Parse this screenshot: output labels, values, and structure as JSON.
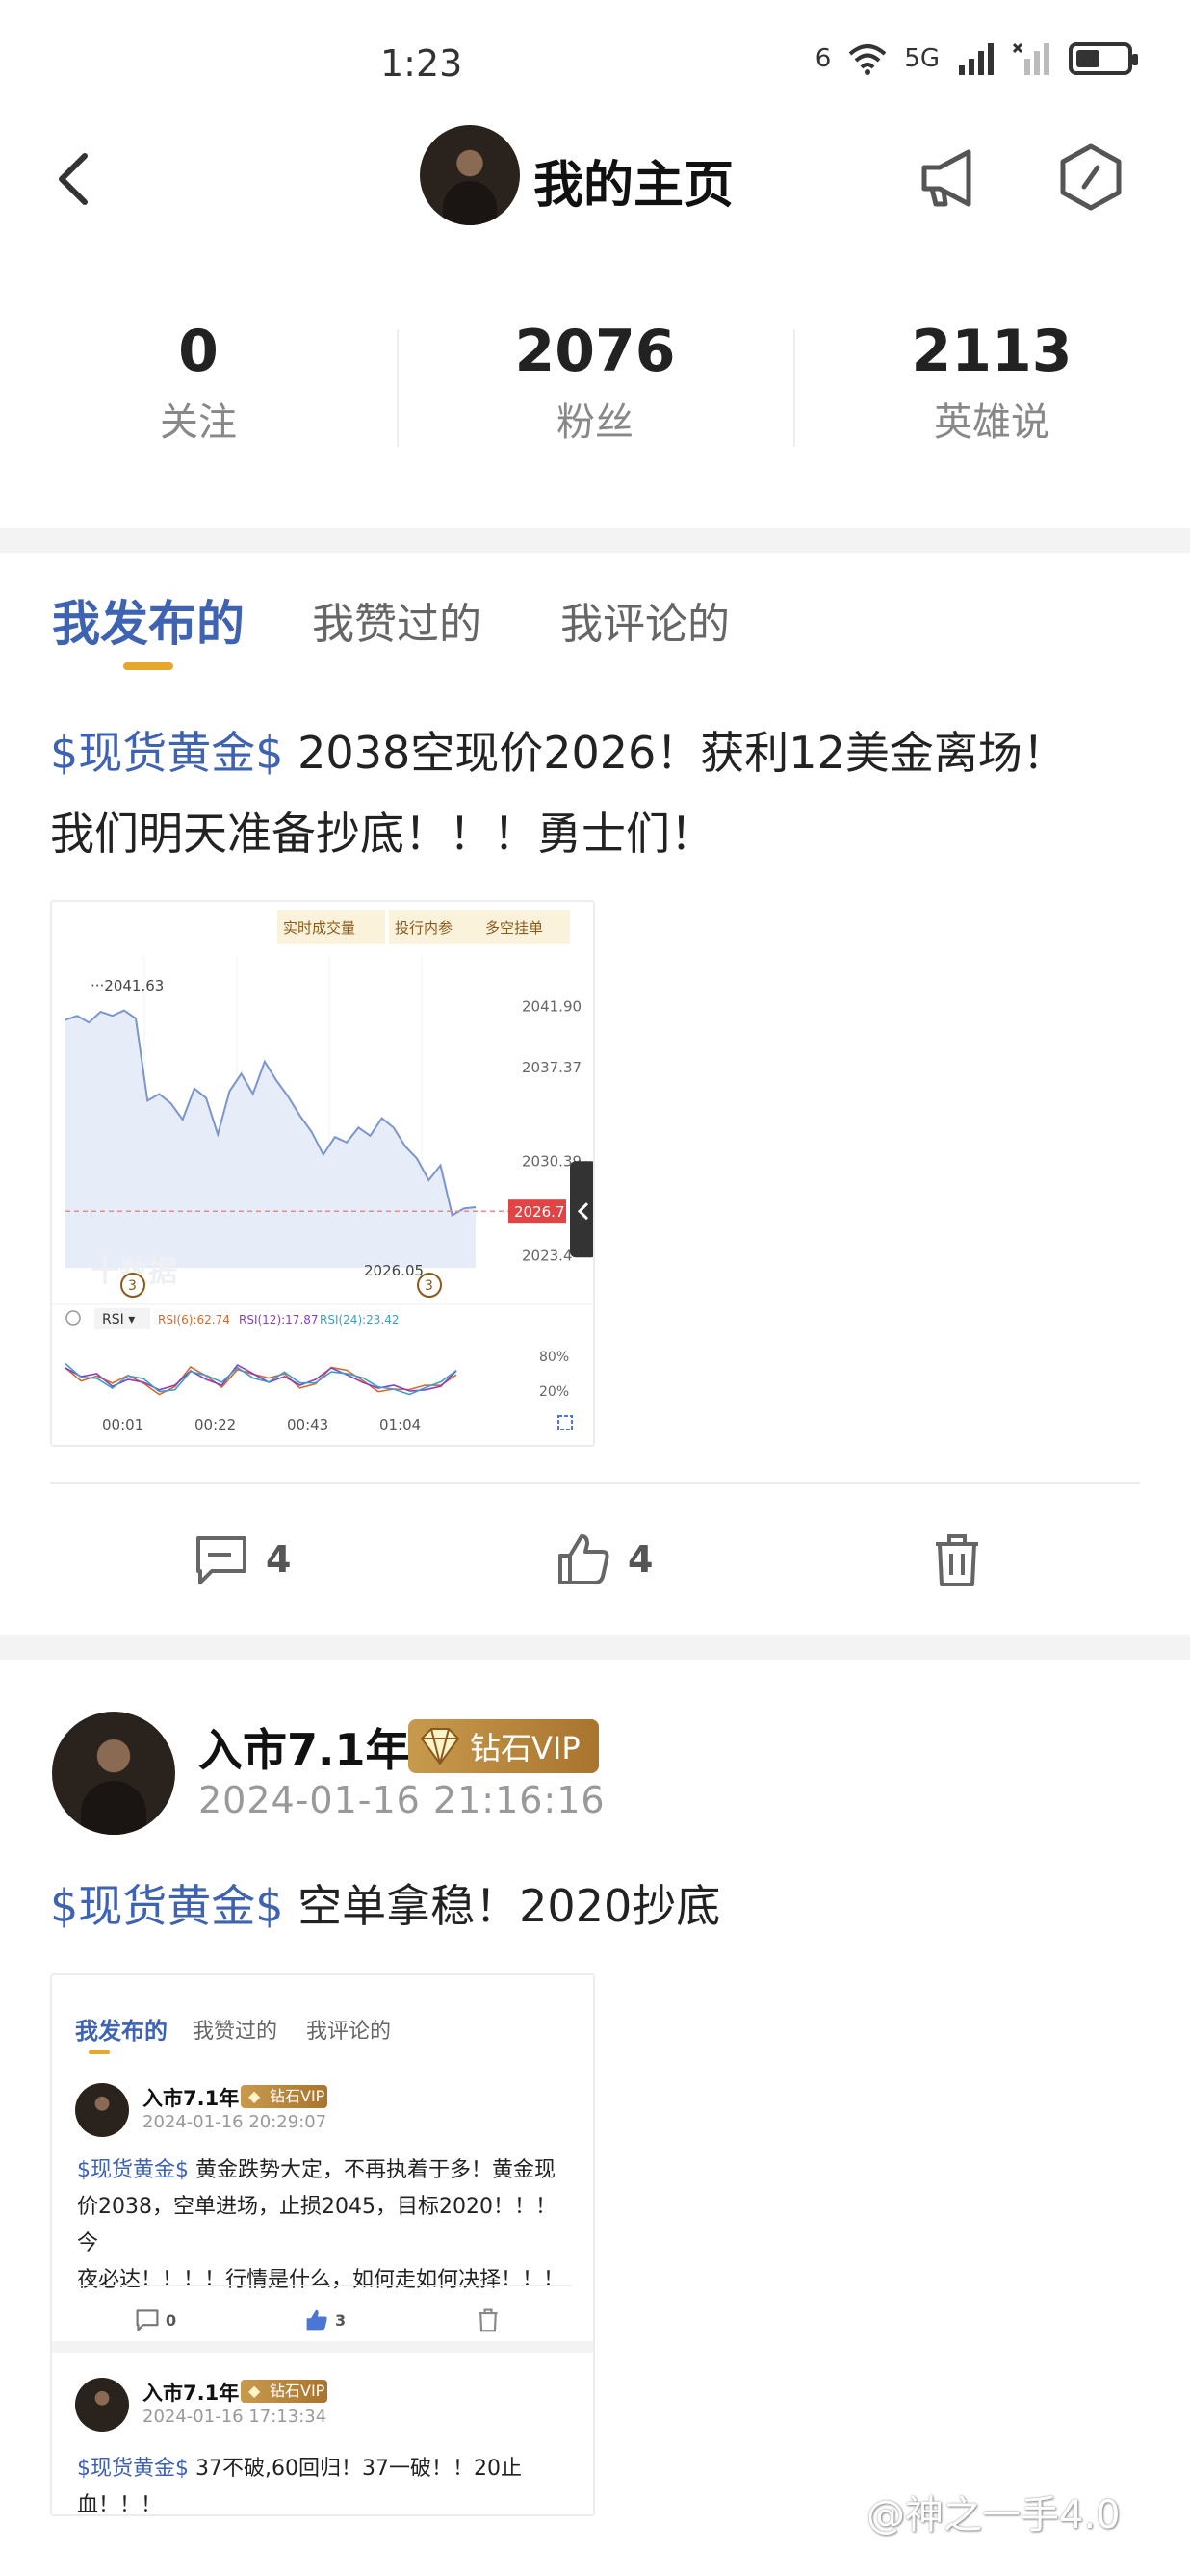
{
  "status_bar": {
    "time": "1:23",
    "signal_labels": [
      "6",
      "5G"
    ]
  },
  "header": {
    "title": "我的主页"
  },
  "stats": [
    {
      "value": "0",
      "label": "关注"
    },
    {
      "value": "2076",
      "label": "粉丝"
    },
    {
      "value": "2113",
      "label": "英雄说"
    }
  ],
  "tabs": [
    {
      "label": "我发布的",
      "active": true
    },
    {
      "label": "我赞过的",
      "active": false
    },
    {
      "label": "我评论的",
      "active": false
    }
  ],
  "post1": {
    "tag": "$现货黄金$",
    "text_line1": " 2038空现价2026！获利12美金离场！",
    "text_line2": "我们明天准备抄底！！！勇士们！",
    "comments": "4",
    "likes": "4"
  },
  "chart_data": {
    "type": "line",
    "buttons": [
      "实时成交量",
      "投行内参",
      "多空挂单"
    ],
    "high_label": "2041.63",
    "low_label": "2026.05",
    "y_ticks": [
      "2041.90",
      "2037.37",
      "2030.39",
      "2023.4"
    ],
    "current_price": "2026.7",
    "x_ticks": [
      "00:01",
      "00:22",
      "00:43",
      "01:04"
    ],
    "indicator": "RSI",
    "rsi_labels": [
      "RSI(6):62.74",
      "RSI(12):17.87",
      "RSI(24):23.42"
    ],
    "rsi_ticks": [
      "80%",
      "20%"
    ],
    "markers": [
      "3",
      "3"
    ],
    "watermark": "十数据",
    "series": [
      {
        "values": [
          2040.9,
          2041.2,
          2040.7,
          2041.5,
          2041.2,
          2041.6,
          2041.0,
          2034.9,
          2035.4,
          2034.7,
          2033.5,
          2035.8,
          2035.1,
          2032.4,
          2035.6,
          2036.9,
          2035.4,
          2037.8,
          2036.4,
          2035.2,
          2033.8,
          2032.6,
          2030.9,
          2032.2,
          2031.8,
          2032.9,
          2032.3,
          2033.6,
          2032.9,
          2031.5,
          2030.6,
          2029.0,
          2030.1,
          2026.4,
          2026.9,
          2027.0
        ]
      },
      {
        "values": [
          60,
          45,
          50,
          28,
          40,
          35,
          22,
          30,
          55,
          40,
          30,
          65,
          50,
          35,
          45,
          30,
          40,
          60,
          48,
          35,
          25,
          30,
          20,
          22,
          28,
          55
        ]
      }
    ]
  },
  "post2": {
    "author": "入市7.1年",
    "vip": "钻石VIP",
    "time": "2024-01-16 21:16:16",
    "tag": "$现货黄金$",
    "text": " 空单拿稳！2020抄底"
  },
  "embed": {
    "tabs": [
      "我发布的",
      "我赞过的",
      "我评论的"
    ],
    "post_a": {
      "author": "入市7.1年",
      "vip": "钻石VIP",
      "time": "2024-01-16 20:29:07",
      "tag": "$现货黄金$",
      "text_l1": " 黄金跌势大定，不再执着于多！黄金现",
      "text_l2": "价2038，空单进场，止损2045，目标2020！！！今",
      "text_l3": "夜必达！！！！行情是什么，如何走如何决择！！！",
      "comments": "0",
      "likes": "3"
    },
    "post_b": {
      "author": "入市7.1年",
      "vip": "钻石VIP",
      "time": "2024-01-16 17:13:34",
      "tag": "$现货黄金$",
      "text": " 37不破,60回归！37一破！！20止血！！！"
    }
  },
  "watermark": "@神之一手4.0"
}
